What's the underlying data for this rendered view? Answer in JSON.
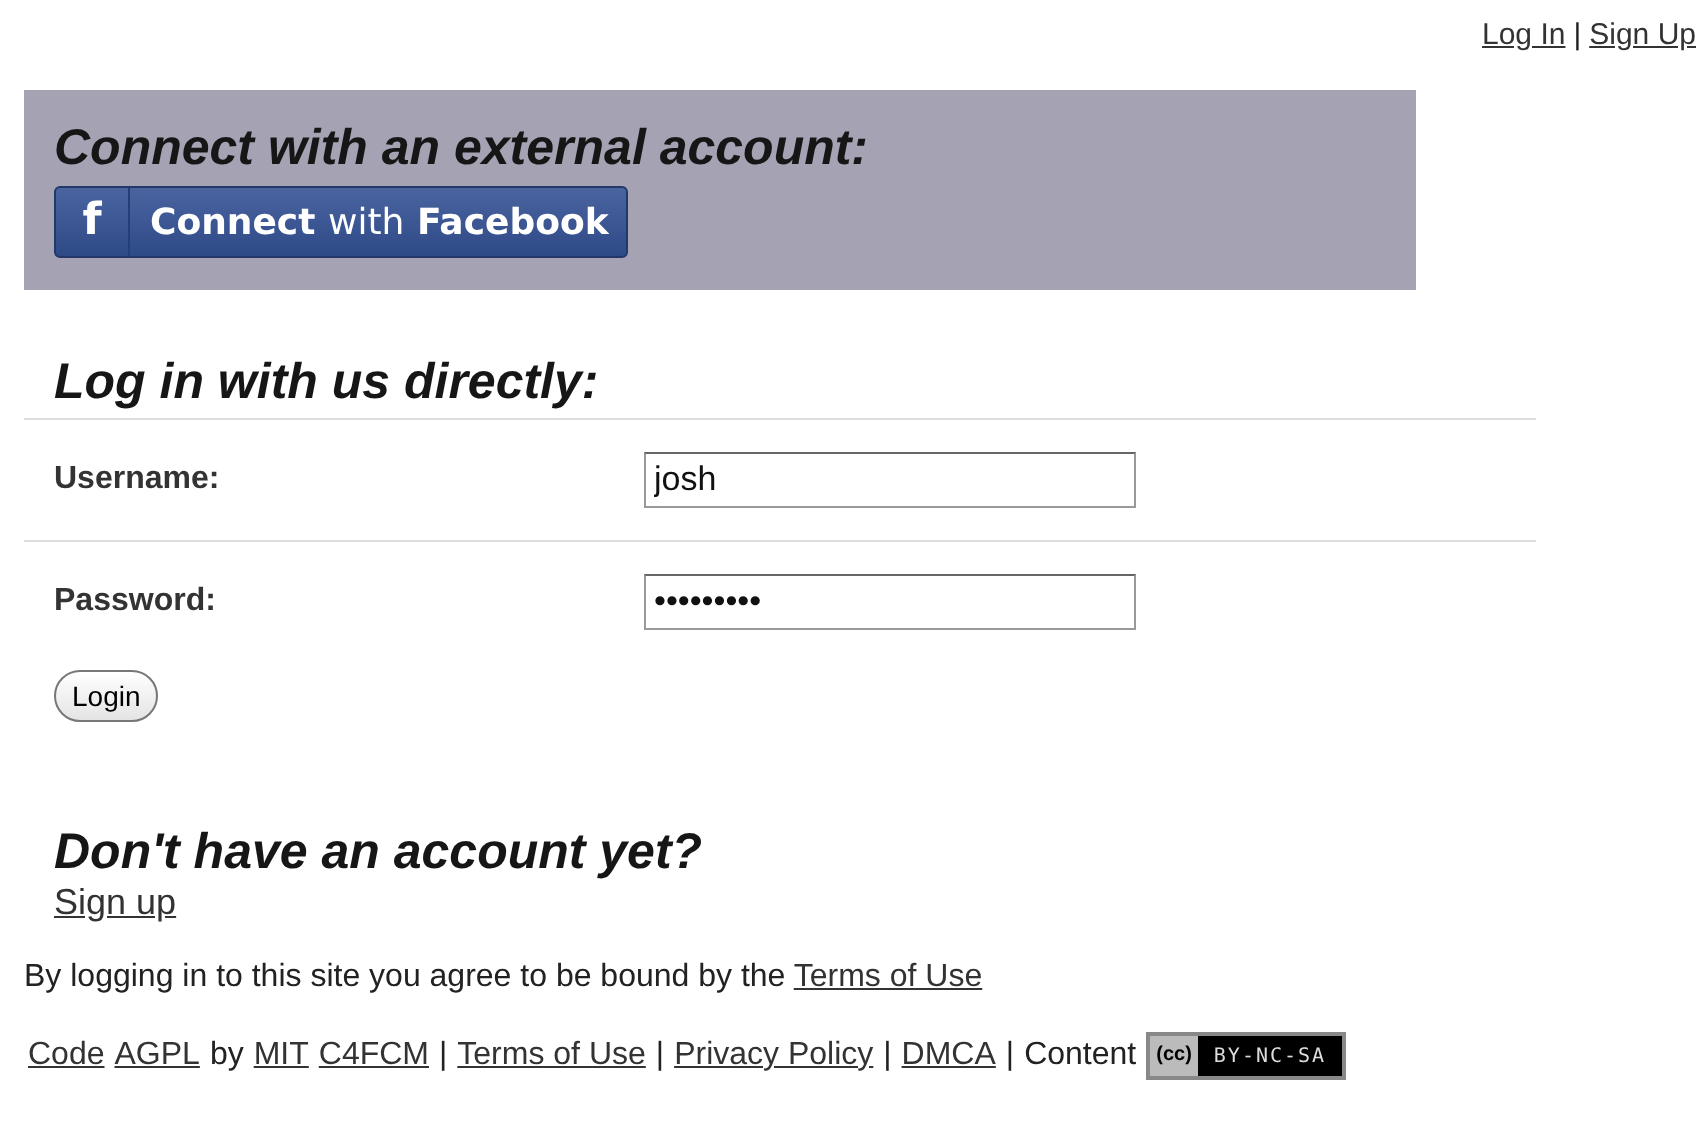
{
  "top_links": [
    {
      "kind": "link",
      "text": "Log In"
    },
    {
      "kind": "text",
      "text": "|"
    },
    {
      "kind": "link",
      "text": "Sign Up"
    }
  ],
  "external": {
    "heading": "Connect with an external account:",
    "button": {
      "icon": "f",
      "label_light": "Connect",
      "label": "with",
      "label_bold": "Facebook"
    }
  },
  "direct": {
    "heading": "Log in with us directly:",
    "fields": [
      {
        "label": "Username:",
        "value": "josh"
      },
      {
        "label": "Password:",
        "value": "•••••••••"
      }
    ],
    "button": "Login"
  },
  "signup": {
    "heading": "Don't have an account yet?",
    "link": "Sign up"
  },
  "agreement": {
    "text": "By logging in to this site you agree to be bound by the",
    "link": "Terms of Use"
  },
  "footer": [
    {
      "kind": "link",
      "text": "Code"
    },
    {
      "kind": "link",
      "text": "AGPL"
    },
    {
      "kind": "text",
      "text": "by"
    },
    {
      "kind": "link",
      "text": "MIT"
    },
    {
      "kind": "link",
      "text": "C4FCM"
    },
    {
      "kind": "text",
      "text": "|"
    },
    {
      "kind": "link",
      "text": "Terms of Use"
    },
    {
      "kind": "text",
      "text": "|"
    },
    {
      "kind": "link",
      "text": "Privacy Policy"
    },
    {
      "kind": "text",
      "text": "|"
    },
    {
      "kind": "link",
      "text": "DMCA"
    },
    {
      "kind": "text",
      "text": "|"
    },
    {
      "kind": "text",
      "text": "Content"
    },
    {
      "kind": "badge",
      "cc": "(cc)",
      "text": "BY-NC-SA"
    }
  ]
}
